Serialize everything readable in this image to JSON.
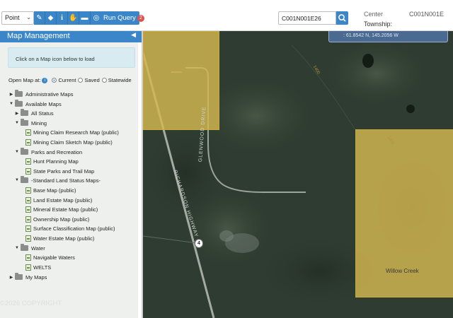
{
  "toolbar": {
    "tool_select": {
      "value": "Point",
      "options_visible": [
        "Point"
      ]
    },
    "tools": [
      {
        "name": "draw-tool",
        "icon": "pencil-icon",
        "glyph": "✎"
      },
      {
        "name": "erase-tool",
        "icon": "eraser-icon",
        "glyph": "⌫"
      },
      {
        "name": "info-tool",
        "icon": "info-icon",
        "glyph": "i"
      },
      {
        "name": "pan-tool",
        "icon": "hand-icon",
        "glyph": "✋"
      },
      {
        "name": "measure-tool",
        "icon": "ruler-icon",
        "glyph": "📏"
      },
      {
        "name": "target-tool",
        "icon": "target-icon",
        "glyph": "◎"
      }
    ],
    "run_query_label": "Run Query",
    "run_query_count": "2",
    "search_value": "C001N001E26",
    "center_label": "Center",
    "center_value": "C001N001E",
    "township_label": "Township:"
  },
  "panel": {
    "title": "Map Management",
    "hint": "Click on a Map icon below to load",
    "open_map_at_label": "Open Map at:",
    "open_options": [
      {
        "label": "Current",
        "selected": true
      },
      {
        "label": "Saved",
        "selected": false
      },
      {
        "label": "Statewide",
        "selected": false
      }
    ],
    "tree": [
      {
        "label": "Administrative Maps",
        "type": "folder",
        "expanded": false
      },
      {
        "label": "Available Maps",
        "type": "folder",
        "expanded": true
      },
      {
        "label": "All Status",
        "type": "folder",
        "expanded": false
      },
      {
        "label": "Mining",
        "type": "folder",
        "expanded": true
      },
      {
        "label": "Mining Claim Research Map (public)",
        "type": "map"
      },
      {
        "label": "Mining Claim Sketch Map (public)",
        "type": "map"
      },
      {
        "label": "Parks and Recreation",
        "type": "folder",
        "expanded": true
      },
      {
        "label": "Hunt Planning Map",
        "type": "map"
      },
      {
        "label": "State Parks and Trail Map",
        "type": "map"
      },
      {
        "label": "-Standard Land Status Maps-",
        "type": "folder",
        "expanded": true
      },
      {
        "label": "Base Map (public)",
        "type": "map"
      },
      {
        "label": "Land Estate Map (public)",
        "type": "map"
      },
      {
        "label": "Mineral Estate Map (public)",
        "type": "map"
      },
      {
        "label": "Ownership Map (public)",
        "type": "map"
      },
      {
        "label": "Surface Classification Map (public)",
        "type": "map"
      },
      {
        "label": "Water Estate Map (public)",
        "type": "map"
      },
      {
        "label": "Water",
        "type": "folder",
        "expanded": true
      },
      {
        "label": "Navigable Waters",
        "type": "map"
      },
      {
        "label": "WELTS",
        "type": "map"
      },
      {
        "label": "My Maps",
        "type": "folder",
        "expanded": false
      }
    ]
  },
  "map": {
    "coordinates": ": 61.8542 N, 145.2056 W",
    "road_highway": "RICHARDSON HIGHWAY",
    "road_drive": "GLENWOOD DRIVE",
    "route_number": "4",
    "contour_labels": [
      "1400",
      "1400"
    ],
    "place_name": "Willow Creek",
    "colors": {
      "parcel_fill": "#d4b850",
      "accent": "#3a86c8",
      "imagery": "#2e3b30"
    }
  },
  "copyright": "©2026 COPYRIGHT"
}
